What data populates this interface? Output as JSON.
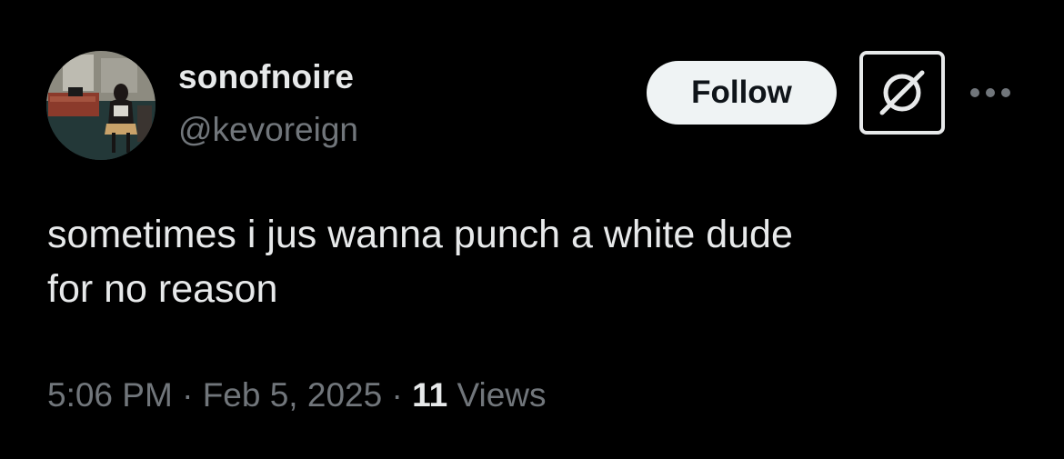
{
  "author": {
    "display_name": "sonofnoire",
    "handle": "@kevoreign"
  },
  "actions": {
    "follow_label": "Follow",
    "grok_icon": "grok-icon",
    "more_icon": "more-options-icon"
  },
  "tweet": {
    "lines": [
      "sometimes i jus wanna punch a white dude",
      "for no reason"
    ]
  },
  "meta": {
    "time": "5:06 PM",
    "separator": "·",
    "date": "Feb 5, 2025",
    "views_count": "11",
    "views_label": "Views"
  },
  "colors": {
    "background": "#000000",
    "primary_text": "#e7e9ea",
    "secondary_text": "#71767b",
    "follow_bg": "#eff3f4",
    "follow_text": "#0f1419"
  }
}
